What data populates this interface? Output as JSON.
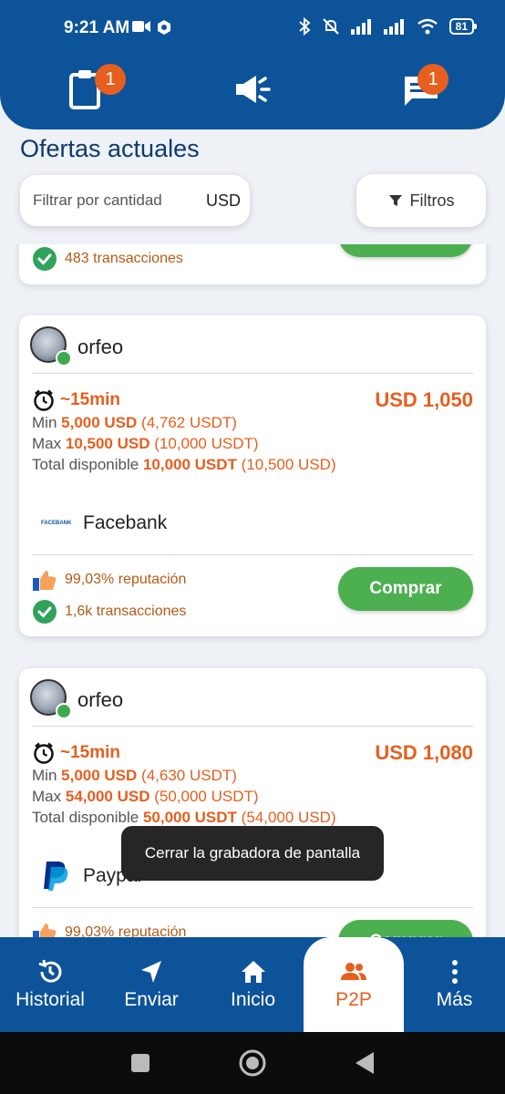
{
  "status_bar": {
    "time": "9:21 AM",
    "battery": "81"
  },
  "top_nav": {
    "orders_badge": "1",
    "chat_badge": "1"
  },
  "page": {
    "title": "Ofertas actuales"
  },
  "filter": {
    "placeholder": "Filtrar por cantidad",
    "currency": "USD",
    "filters_label": "Filtros"
  },
  "partial_card": {
    "transactions": "483 transacciones"
  },
  "offers": [
    {
      "username": "orfeo",
      "time": "~15min",
      "price": "USD 1,050",
      "min_label": "Min",
      "min_amount": "5,000 USD",
      "min_usdt": "(4,762 USDT)",
      "max_label": "Max",
      "max_amount": "10,500 USD",
      "max_usdt": "(10,000 USDT)",
      "total_label": "Total disponible",
      "total_amount": "10,000 USDT",
      "total_usd": "(10,500 USD)",
      "bank_logo": "FACEBANK",
      "bank": "Facebank",
      "reputation": "99,03% reputación",
      "transactions": "1,6k transacciones",
      "buy_label": "Comprar"
    },
    {
      "username": "orfeo",
      "time": "~15min",
      "price": "USD 1,080",
      "min_label": "Min",
      "min_amount": "5,000 USD",
      "min_usdt": "(4,630 USDT)",
      "max_label": "Max",
      "max_amount": "54,000 USD",
      "max_usdt": "(50,000 USDT)",
      "total_label": "Total disponible",
      "total_amount": "50,000 USDT",
      "total_usd": "(54,000 USD)",
      "bank": "Paypal",
      "reputation": "99,03% reputación",
      "buy_label": "Comprar"
    }
  ],
  "toast": "Cerrar la grabadora de pantalla",
  "bottom_nav": {
    "history": "Historial",
    "send": "Enviar",
    "home": "Inicio",
    "p2p": "P2P",
    "more": "Más"
  },
  "colors": {
    "primary": "#0d5399",
    "accent": "#e65f1f",
    "success": "#4caf50"
  }
}
